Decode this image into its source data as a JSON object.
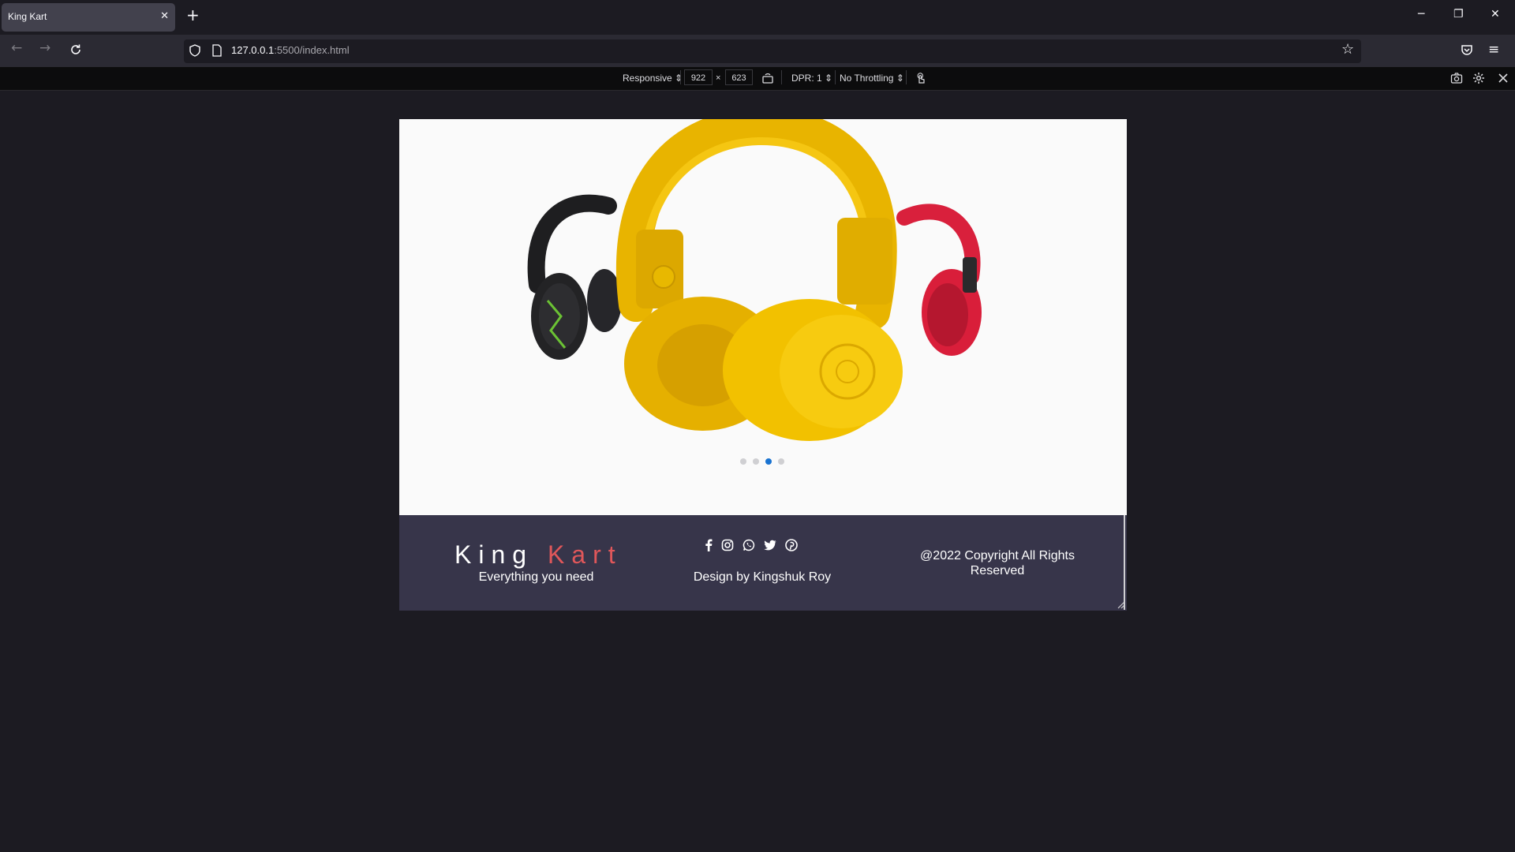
{
  "browser": {
    "tab_title": "King Kart",
    "tab_close_glyph": "✕",
    "new_tab_glyph": "+",
    "url_host": "127.0.0.1",
    "url_path": ":5500/index.html",
    "window_controls": {
      "minimize": "─",
      "restore": "❐",
      "close": "✕"
    }
  },
  "rdm_toolbar": {
    "device": "Responsive ⇕",
    "width": "922",
    "times": "×",
    "height": "623",
    "dpr": "DPR: 1 ⇕",
    "throttling": "No Throttling ⇕"
  },
  "page": {
    "carousel": {
      "slide_count": 4,
      "active_slide": 3,
      "image_subject": "yellow, black and red headphones"
    },
    "footer": {
      "brand_first": "King",
      "brand_second": "Kart",
      "tagline": "Everything you need",
      "social_icons": [
        "facebook-icon",
        "instagram-icon",
        "whatsapp-icon",
        "twitter-icon",
        "pinterest-icon"
      ],
      "designer": "Design by Kingshuk Roy",
      "copyright": "@2022 Copyright All Rights Reserved"
    }
  },
  "colors": {
    "browser_bg": "#1c1b22",
    "page_bg": "#fafafa",
    "footer_bg": "#37354a",
    "brand_accent": "#e0575a",
    "dot_active": "#1973d1",
    "dot_inactive": "#cfcfd2"
  }
}
